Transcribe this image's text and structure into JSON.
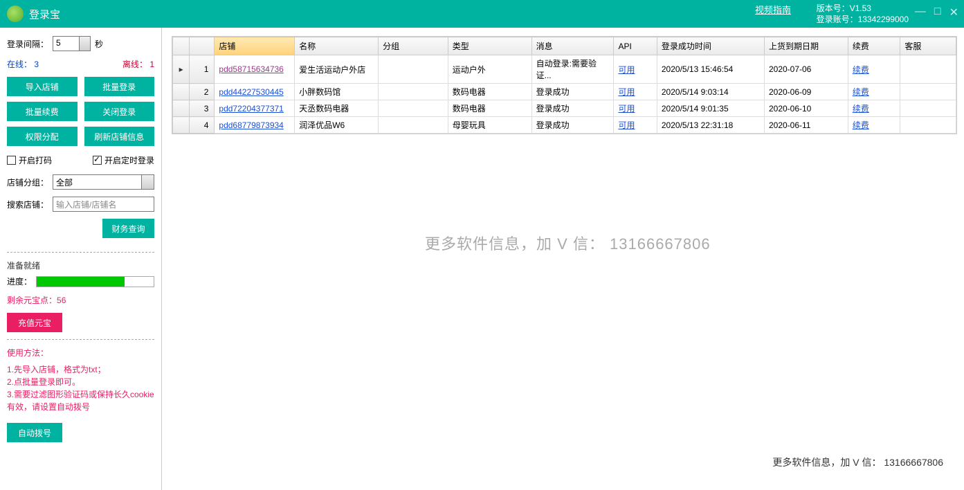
{
  "header": {
    "title": "登录宝",
    "video_guide": "视频指南",
    "version_label": "版本号：",
    "version_value": "V1.53",
    "account_label": "登录账号：",
    "account_value": "13342299000"
  },
  "sidebar": {
    "interval_label": "登录间隔：",
    "interval_value": "5",
    "seconds": "秒",
    "online_label": "在线：",
    "online_count": "3",
    "offline_label": "离线：",
    "offline_count": "1",
    "btn_import": "导入店铺",
    "btn_batch_login": "批量登录",
    "btn_batch_renew": "批量续费",
    "btn_close_login": "关闭登录",
    "btn_permission": "权限分配",
    "btn_refresh": "刷新店铺信息",
    "chk_captcha": "开启打码",
    "chk_timed": "开启定时登录",
    "group_label": "店铺分组：",
    "group_value": "全部",
    "search_label": "搜索店铺：",
    "search_placeholder": "输入店铺/店铺名",
    "btn_finance": "财务查询",
    "ready_label": "准备就绪",
    "progress_label": "进度：",
    "points_label": "剩余元宝点：",
    "points_value": "56",
    "btn_recharge": "充值元宝",
    "usage_title": "使用方法：",
    "usage_text": "1.先导入店铺，格式为txt；\n2.点批量登录即可。\n3.需要过滤图形验证码或保持长久cookie有效，请设置自动拨号",
    "btn_autodial": "自动拨号"
  },
  "table": {
    "headers": {
      "shop": "店铺",
      "name": "名称",
      "group": "分组",
      "type": "类型",
      "message": "消息",
      "api": "API",
      "login_time": "登录成功时间",
      "expire": "上货到期日期",
      "renew": "续费",
      "cs": "客服"
    },
    "rows": [
      {
        "num": "1",
        "shop": "pdd58715634736",
        "shop_cls": "link-visited",
        "name": "爱生活运动户外店",
        "group": "",
        "type": "运动户外",
        "msg": "自动登录:需要验证...",
        "api": "可用",
        "time": "2020/5/13 15:46:54",
        "expire": "2020-07-06",
        "renew": "续费",
        "indicator": "▸"
      },
      {
        "num": "2",
        "shop": "pdd44227530445",
        "shop_cls": "link",
        "name": "小胖数码馆",
        "group": "",
        "type": "数码电器",
        "msg": "登录成功",
        "api": "可用",
        "time": "2020/5/14 9:03:14",
        "expire": "2020-06-09",
        "renew": "续费",
        "indicator": ""
      },
      {
        "num": "3",
        "shop": "pdd72204377371",
        "shop_cls": "link",
        "name": "天丞数码电器",
        "group": "",
        "type": "数码电器",
        "msg": "登录成功",
        "api": "可用",
        "time": "2020/5/14 9:01:35",
        "expire": "2020-06-10",
        "renew": "续费",
        "indicator": ""
      },
      {
        "num": "4",
        "shop": "pdd68779873934",
        "shop_cls": "link",
        "name": "润泽优品W6",
        "group": "",
        "type": "母婴玩具",
        "msg": "登录成功",
        "api": "可用",
        "time": "2020/5/13 22:31:18",
        "expire": "2020-06-11",
        "renew": "续费",
        "indicator": ""
      }
    ]
  },
  "watermark": {
    "text1": "更多软件信息，加 V 信： 13166667806",
    "text2": "更多软件信息，加 V 信： 13166667806"
  }
}
